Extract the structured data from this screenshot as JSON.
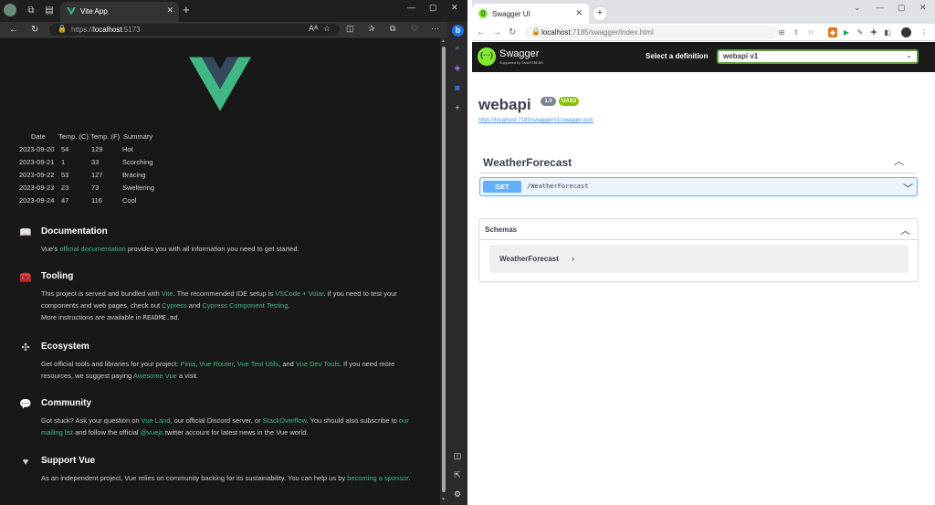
{
  "left_browser": {
    "tab_title": "Vite App",
    "url_prefix": "https://",
    "url_host": "localhost",
    "url_rest": ":5173",
    "weather_table": {
      "headers": [
        "Date",
        "Temp. (C)",
        "Temp. (F)",
        "Summary"
      ],
      "rows": [
        [
          "2023-09-20",
          "54",
          "129",
          "Hot"
        ],
        [
          "2023-09-21",
          "1",
          "33",
          "Scorching"
        ],
        [
          "2023-09-22",
          "53",
          "127",
          "Bracing"
        ],
        [
          "2023-09-23",
          "23",
          "73",
          "Sweltering"
        ],
        [
          "2023-09-24",
          "47",
          "116",
          "Cool"
        ]
      ]
    },
    "sections": {
      "docs": {
        "title": "Documentation",
        "t1": "Vue's ",
        "l1": "official documentation",
        "t2": " provides you with all information you need to get started."
      },
      "tooling": {
        "title": "Tooling",
        "t1": "This project is served and bundled with ",
        "l1": "Vite",
        "t2": ". The recommended IDE setup is ",
        "l2": "VSCode",
        "t3": " + ",
        "l3": "Volar",
        "t4": ". If you need to test your components and web pages, check out ",
        "l4": "Cypress",
        "t5": " and ",
        "l5": "Cypress Component Testing",
        "t6": ".",
        "t7": "More instructions are available in ",
        "code": "README.md",
        "t8": "."
      },
      "ecosystem": {
        "title": "Ecosystem",
        "t1": "Get official tools and libraries for your project: ",
        "l1": "Pinia",
        "t2": ", ",
        "l2": "Vue Router",
        "t3": ", ",
        "l3": "Vue Test Utils",
        "t4": ", and ",
        "l4": "Vue Dev Tools",
        "t5": ". If you need more resources, we suggest paying ",
        "l5": "Awesome Vue",
        "t6": " a visit."
      },
      "community": {
        "title": "Community",
        "t1": "Got stuck? Ask your question on ",
        "l1": "Vue Land",
        "t2": ", our official Discord server, or ",
        "l2": "StackOverflow",
        "t3": ". You should also subscribe to ",
        "l3": "our mailing list",
        "t4": " and follow the official ",
        "l4": "@vuejs",
        "t5": " twitter account for latest news in the Vue world."
      },
      "support": {
        "title": "Support Vue",
        "t1": "As an independent project, Vue relies on community backing for its sustainability. You can help us by ",
        "l1": "becoming a sponsor",
        "t2": "."
      }
    }
  },
  "right_browser": {
    "tab_title": "Swagger UI",
    "url_host": "localhost",
    "url_rest": ":7185/swagger/index.html",
    "swagger": {
      "brand": "Swagger",
      "brand_sub": "Supported by SMARTBEAR",
      "definition_label": "Select a definition",
      "definition_value": "webapi v1",
      "api_title": "webapi",
      "version_badge": "1.0",
      "oas_badge": "OAS3",
      "spec_link": "https://localhost:7185/swagger/v1/swagger.json",
      "tag": "WeatherForecast",
      "operation": {
        "method": "GET",
        "path": "/WeatherForecast"
      },
      "schemas_title": "Schemas",
      "schema_item": "WeatherForecast"
    }
  },
  "colors": {
    "vue_green": "#41b883",
    "vue_dark": "#34495e",
    "swagger_green": "#85ea2d",
    "get_blue": "#61affe",
    "oas_green": "#89bf04"
  }
}
